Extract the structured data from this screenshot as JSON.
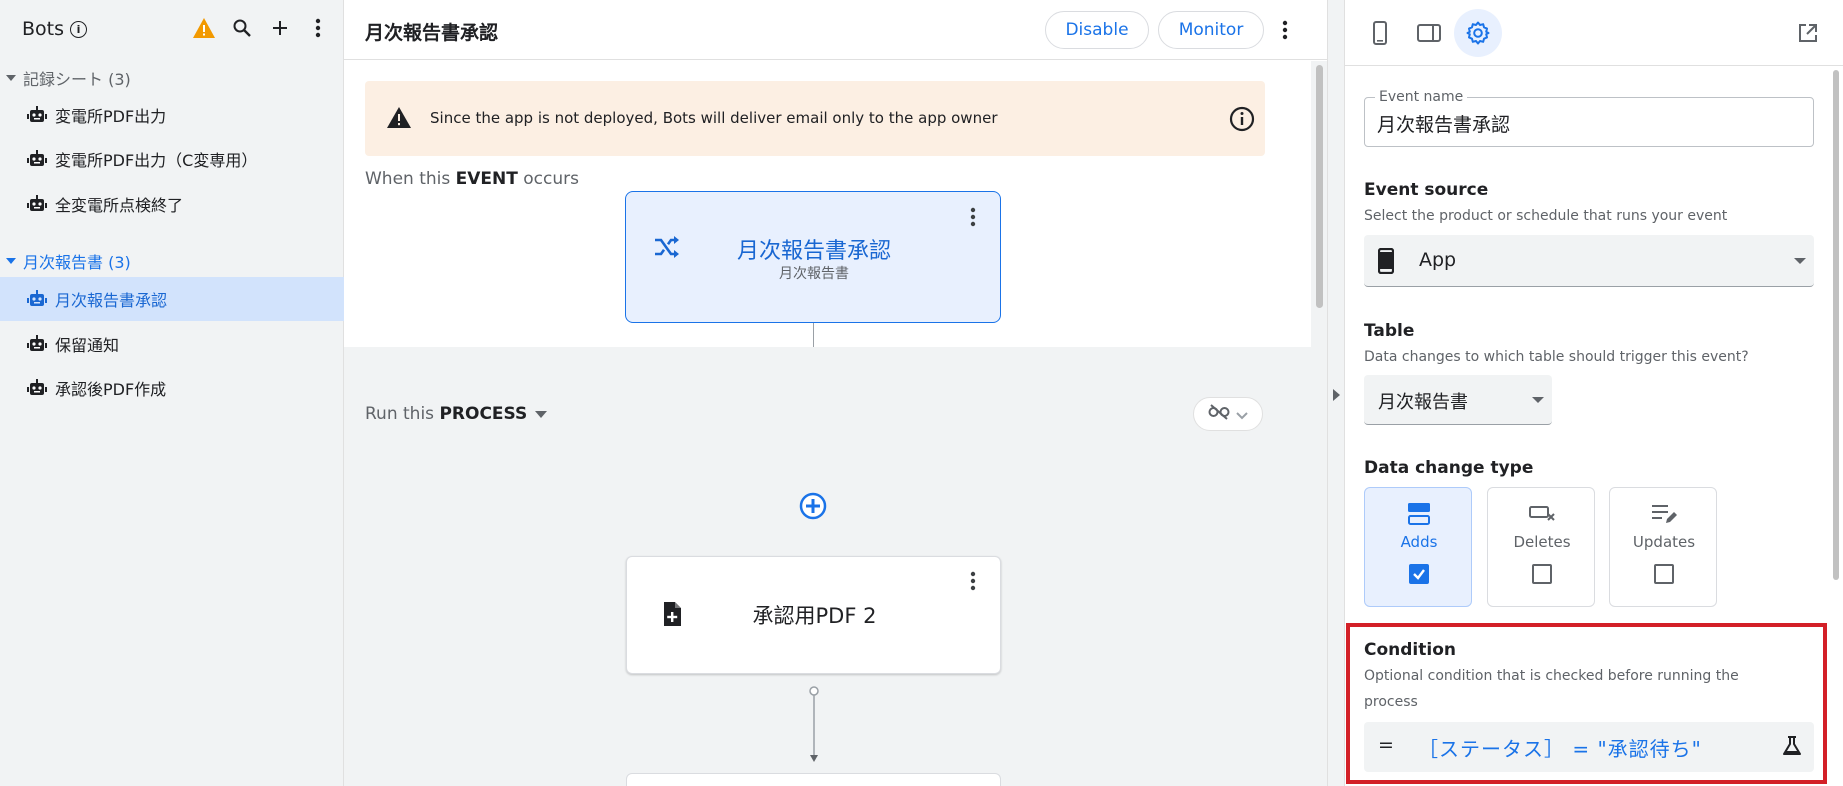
{
  "sidebar": {
    "title": "Bots",
    "groups": [
      {
        "label": "記録シート (3)",
        "items": [
          "変電所PDF出力",
          "変電所PDF出力（C変専用）",
          "全変電所点検終了"
        ]
      },
      {
        "label": "月次報告書 (3)",
        "items": [
          "月次報告書承認",
          "保留通知",
          "承認後PDF作成"
        ]
      }
    ],
    "active_item": "月次報告書承認"
  },
  "header": {
    "title": "月次報告書承認",
    "disable_label": "Disable",
    "monitor_label": "Monitor"
  },
  "canvas": {
    "banner_text": "Since the app is not deployed, Bots will deliver email only to the app owner",
    "event_label_prefix": "When this ",
    "event_label_keyword": "EVENT",
    "event_label_suffix": " occurs",
    "event_card": {
      "title": "月次報告書承認",
      "subtitle": "月次報告書"
    },
    "process_label_prefix": "Run this ",
    "process_label_keyword": "PROCESS",
    "step_card": {
      "title": "承認用PDF 2"
    }
  },
  "panel": {
    "event_name_label": "Event name",
    "event_name_value": "月次報告書承認",
    "event_source": {
      "title": "Event source",
      "description": "Select the product or schedule that runs your event",
      "value": "App"
    },
    "table": {
      "title": "Table",
      "description": "Data changes to which table should trigger this event?",
      "value": "月次報告書"
    },
    "data_change_type": {
      "title": "Data change type",
      "options": [
        {
          "label": "Adds",
          "checked": true
        },
        {
          "label": "Deletes",
          "checked": false
        },
        {
          "label": "Updates",
          "checked": false
        }
      ]
    },
    "condition": {
      "title": "Condition",
      "description": "Optional condition that is checked before running the process",
      "eq": "=",
      "expression": "［ステータス］ = \"承認待ち\""
    }
  },
  "colors": {
    "accent": "#1a73e8",
    "warning": "#f29900",
    "highlight_box": "#d32027",
    "banner_bg": "#fcefe3",
    "selected_bg": "#e8f0fe"
  },
  "icons": [
    "info-icon",
    "warning-icon",
    "search-icon",
    "add-icon",
    "more-vert-icon",
    "robot-icon",
    "shuffle-icon",
    "link-off-icon",
    "add-circle-icon",
    "note-add-icon",
    "phone-icon",
    "tablet-icon",
    "gear-icon",
    "open-in-new-icon",
    "flask-icon"
  ]
}
